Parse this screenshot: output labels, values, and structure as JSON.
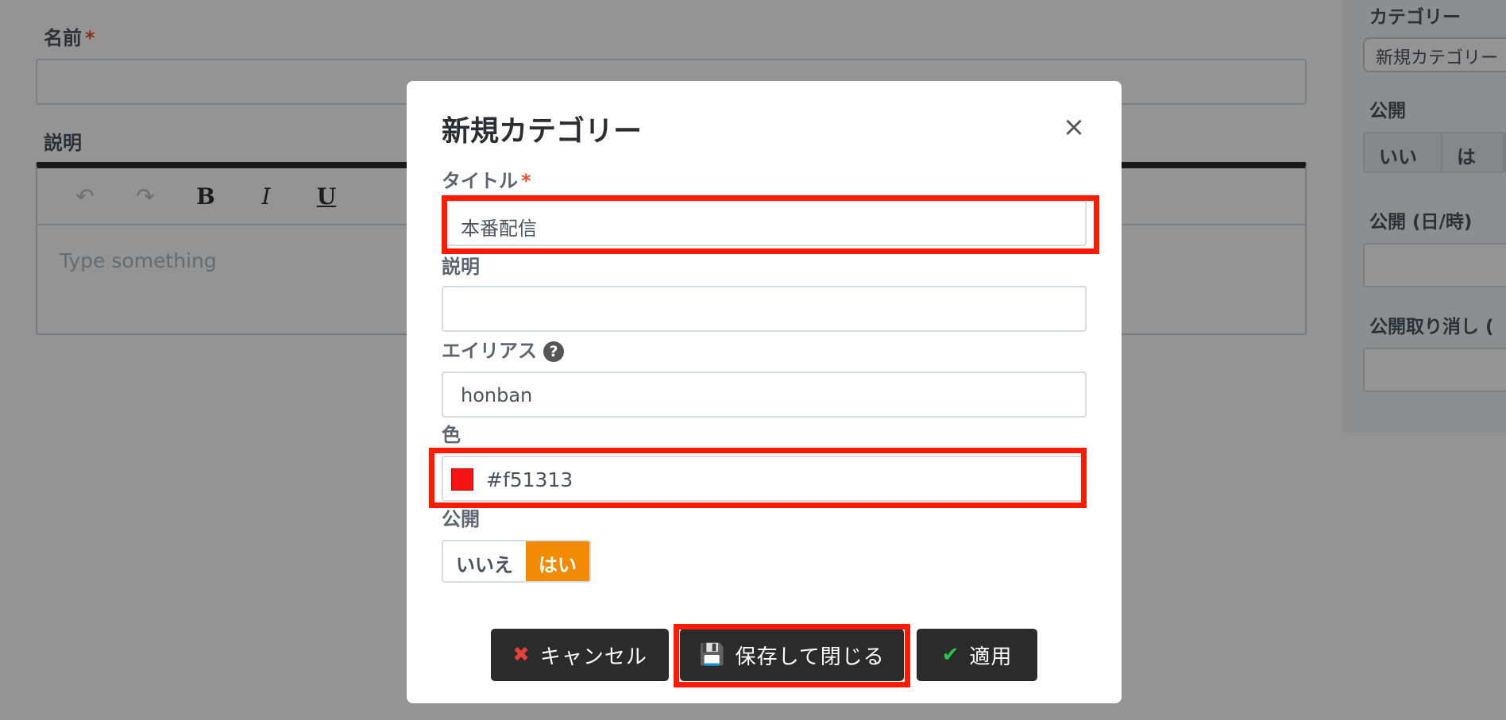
{
  "background": {
    "name_label": "名前",
    "required_mark": "*",
    "description_label": "説明",
    "editor": {
      "undo_icon": "↶",
      "redo_icon": "↷",
      "bold": "B",
      "italic": "I",
      "underline": "U",
      "placeholder": "Type something"
    },
    "sidebar": {
      "category_label": "カテゴリー",
      "category_value": "新規カテゴリー",
      "publish_label": "公開",
      "publish_no": "いいえ",
      "publish_yes": "はい",
      "publish_datetime_label": "公開 (日/時)",
      "unpublish_label": "公開取り消し ("
    }
  },
  "modal": {
    "title": "新規カテゴリー",
    "close_icon": "×",
    "title_label": "タイトル",
    "required_mark": "*",
    "title_value": "本番配信",
    "description_label": "説明",
    "description_value": "",
    "alias_label": "エイリアス",
    "help_icon": "?",
    "alias_value": "honban",
    "color_label": "色",
    "color_value": "#f51313",
    "publish_label": "公開",
    "publish_no": "いいえ",
    "publish_yes": "はい",
    "publish_selected": "はい",
    "cancel_icon": "✖",
    "cancel_label": "キャンセル",
    "save_close_icon": "💾",
    "save_close_label": "保存して閉じる",
    "apply_icon": "✔",
    "apply_label": "適用"
  },
  "colors": {
    "accent_orange": "#f38b00",
    "highlight_red": "#ff1a00",
    "swatch": "#f51313",
    "button_dark": "#2b2b2b"
  }
}
